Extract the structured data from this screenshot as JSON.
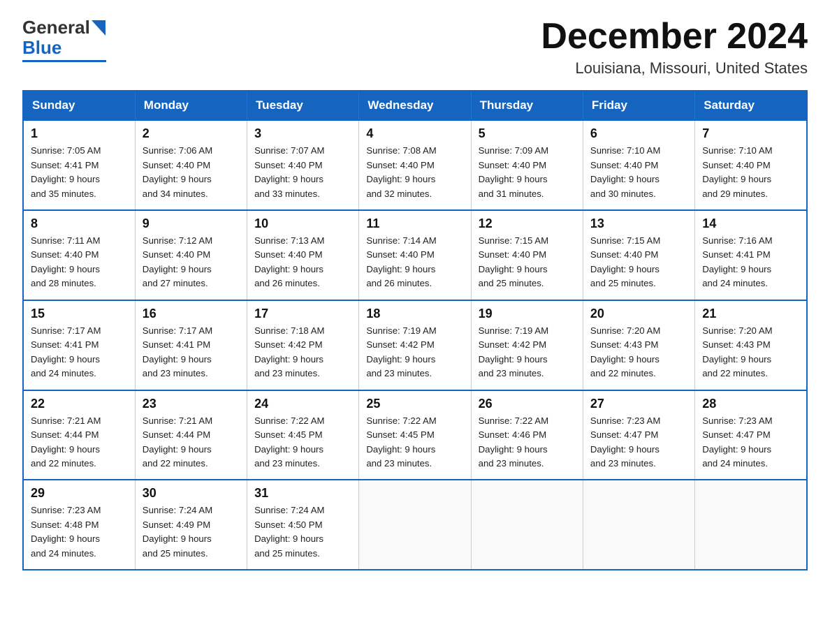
{
  "logo": {
    "general": "General",
    "blue": "Blue"
  },
  "header": {
    "month": "December 2024",
    "location": "Louisiana, Missouri, United States"
  },
  "weekdays": [
    "Sunday",
    "Monday",
    "Tuesday",
    "Wednesday",
    "Thursday",
    "Friday",
    "Saturday"
  ],
  "weeks": [
    [
      {
        "day": "1",
        "sunrise": "7:05 AM",
        "sunset": "4:41 PM",
        "daylight": "9 hours and 35 minutes."
      },
      {
        "day": "2",
        "sunrise": "7:06 AM",
        "sunset": "4:40 PM",
        "daylight": "9 hours and 34 minutes."
      },
      {
        "day": "3",
        "sunrise": "7:07 AM",
        "sunset": "4:40 PM",
        "daylight": "9 hours and 33 minutes."
      },
      {
        "day": "4",
        "sunrise": "7:08 AM",
        "sunset": "4:40 PM",
        "daylight": "9 hours and 32 minutes."
      },
      {
        "day": "5",
        "sunrise": "7:09 AM",
        "sunset": "4:40 PM",
        "daylight": "9 hours and 31 minutes."
      },
      {
        "day": "6",
        "sunrise": "7:10 AM",
        "sunset": "4:40 PM",
        "daylight": "9 hours and 30 minutes."
      },
      {
        "day": "7",
        "sunrise": "7:10 AM",
        "sunset": "4:40 PM",
        "daylight": "9 hours and 29 minutes."
      }
    ],
    [
      {
        "day": "8",
        "sunrise": "7:11 AM",
        "sunset": "4:40 PM",
        "daylight": "9 hours and 28 minutes."
      },
      {
        "day": "9",
        "sunrise": "7:12 AM",
        "sunset": "4:40 PM",
        "daylight": "9 hours and 27 minutes."
      },
      {
        "day": "10",
        "sunrise": "7:13 AM",
        "sunset": "4:40 PM",
        "daylight": "9 hours and 26 minutes."
      },
      {
        "day": "11",
        "sunrise": "7:14 AM",
        "sunset": "4:40 PM",
        "daylight": "9 hours and 26 minutes."
      },
      {
        "day": "12",
        "sunrise": "7:15 AM",
        "sunset": "4:40 PM",
        "daylight": "9 hours and 25 minutes."
      },
      {
        "day": "13",
        "sunrise": "7:15 AM",
        "sunset": "4:40 PM",
        "daylight": "9 hours and 25 minutes."
      },
      {
        "day": "14",
        "sunrise": "7:16 AM",
        "sunset": "4:41 PM",
        "daylight": "9 hours and 24 minutes."
      }
    ],
    [
      {
        "day": "15",
        "sunrise": "7:17 AM",
        "sunset": "4:41 PM",
        "daylight": "9 hours and 24 minutes."
      },
      {
        "day": "16",
        "sunrise": "7:17 AM",
        "sunset": "4:41 PM",
        "daylight": "9 hours and 23 minutes."
      },
      {
        "day": "17",
        "sunrise": "7:18 AM",
        "sunset": "4:42 PM",
        "daylight": "9 hours and 23 minutes."
      },
      {
        "day": "18",
        "sunrise": "7:19 AM",
        "sunset": "4:42 PM",
        "daylight": "9 hours and 23 minutes."
      },
      {
        "day": "19",
        "sunrise": "7:19 AM",
        "sunset": "4:42 PM",
        "daylight": "9 hours and 23 minutes."
      },
      {
        "day": "20",
        "sunrise": "7:20 AM",
        "sunset": "4:43 PM",
        "daylight": "9 hours and 22 minutes."
      },
      {
        "day": "21",
        "sunrise": "7:20 AM",
        "sunset": "4:43 PM",
        "daylight": "9 hours and 22 minutes."
      }
    ],
    [
      {
        "day": "22",
        "sunrise": "7:21 AM",
        "sunset": "4:44 PM",
        "daylight": "9 hours and 22 minutes."
      },
      {
        "day": "23",
        "sunrise": "7:21 AM",
        "sunset": "4:44 PM",
        "daylight": "9 hours and 22 minutes."
      },
      {
        "day": "24",
        "sunrise": "7:22 AM",
        "sunset": "4:45 PM",
        "daylight": "9 hours and 23 minutes."
      },
      {
        "day": "25",
        "sunrise": "7:22 AM",
        "sunset": "4:45 PM",
        "daylight": "9 hours and 23 minutes."
      },
      {
        "day": "26",
        "sunrise": "7:22 AM",
        "sunset": "4:46 PM",
        "daylight": "9 hours and 23 minutes."
      },
      {
        "day": "27",
        "sunrise": "7:23 AM",
        "sunset": "4:47 PM",
        "daylight": "9 hours and 23 minutes."
      },
      {
        "day": "28",
        "sunrise": "7:23 AM",
        "sunset": "4:47 PM",
        "daylight": "9 hours and 24 minutes."
      }
    ],
    [
      {
        "day": "29",
        "sunrise": "7:23 AM",
        "sunset": "4:48 PM",
        "daylight": "9 hours and 24 minutes."
      },
      {
        "day": "30",
        "sunrise": "7:24 AM",
        "sunset": "4:49 PM",
        "daylight": "9 hours and 25 minutes."
      },
      {
        "day": "31",
        "sunrise": "7:24 AM",
        "sunset": "4:50 PM",
        "daylight": "9 hours and 25 minutes."
      },
      null,
      null,
      null,
      null
    ]
  ],
  "labels": {
    "sunrise": "Sunrise: ",
    "sunset": "Sunset: ",
    "daylight": "Daylight: "
  }
}
